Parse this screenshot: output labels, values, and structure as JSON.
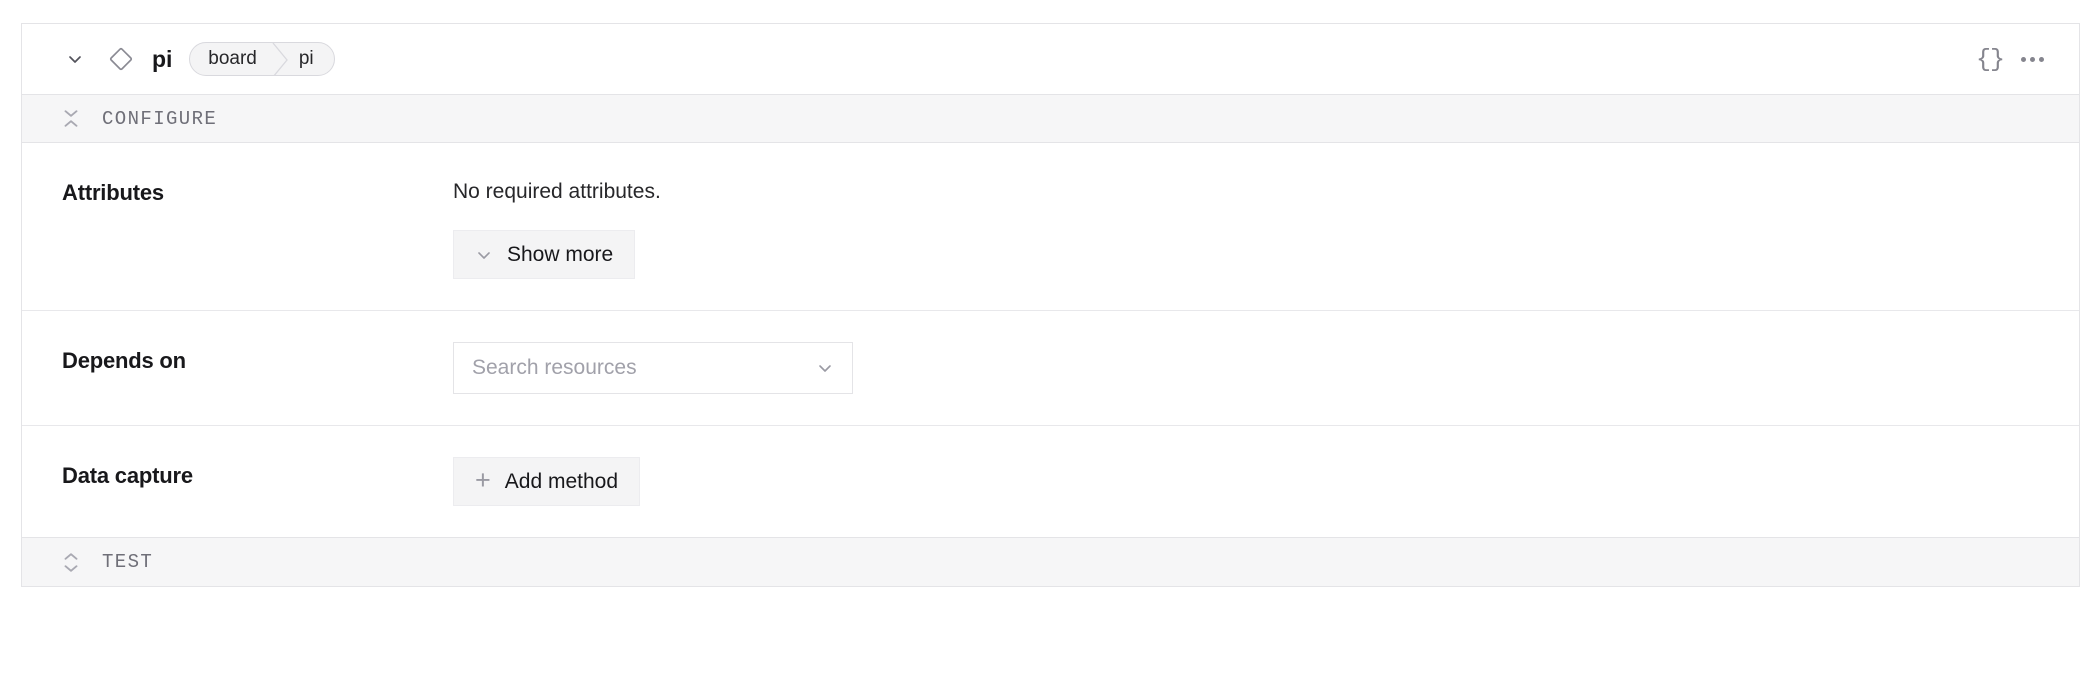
{
  "resource": {
    "collapse_icon": "chevron-down-icon",
    "type_icon": "diamond-icon",
    "name": "pi",
    "breadcrumb": {
      "parent": "board",
      "child": "pi"
    },
    "actions": {
      "json_label": "{}",
      "json_icon": "json-braces-icon",
      "more_icon": "ellipsis-icon"
    }
  },
  "sections": {
    "configure": {
      "title": "CONFIGURE",
      "toggle_icon": "collapse-icon"
    },
    "test": {
      "title": "TEST",
      "toggle_icon": "expand-icon"
    }
  },
  "rows": {
    "attributes": {
      "label": "Attributes",
      "note": "No required attributes.",
      "show_more_label": "Show more",
      "show_more_icon": "chevron-down-icon"
    },
    "depends_on": {
      "label": "Depends on",
      "placeholder": "Search resources",
      "value": "",
      "chevron_icon": "chevron-down-icon"
    },
    "data_capture": {
      "label": "Data capture",
      "add_method_label": "Add method",
      "add_icon": "plus-icon"
    }
  },
  "colors": {
    "border": "#e4e4e7",
    "section_bg": "#f6f6f7",
    "button_bg": "#f4f4f5",
    "text": "#18181b",
    "muted": "#a1a1aa"
  }
}
